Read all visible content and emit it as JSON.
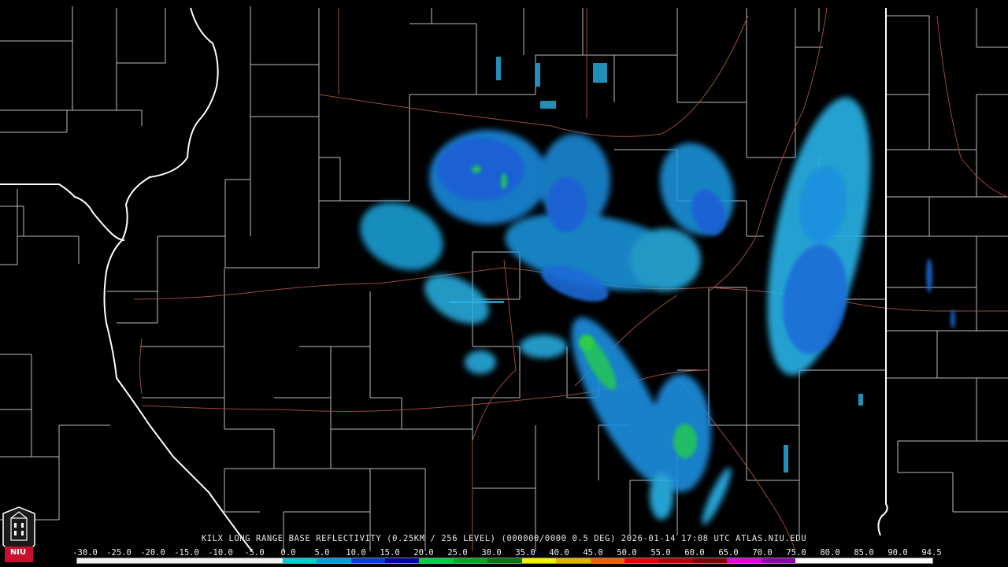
{
  "product": {
    "caption": "KILX LONG RANGE BASE REFLECTIVITY (0.25KM / 256 LEVEL) (000000/0000 0.5 DEG) 2026-01-14 17:08 UTC  ATLAS.NIU.EDU",
    "station": "KILX",
    "date": "2026-01-14",
    "time_utc": "17:08"
  },
  "logo": {
    "text": "NIU",
    "color": "#c8102e"
  },
  "scale": {
    "labels": [
      "-30.0",
      "-25.0",
      "-20.0",
      "-15.0",
      "-10.0",
      "-5.0",
      "0.0",
      "5.0",
      "10.0",
      "15.0",
      "20.0",
      "25.0",
      "30.0",
      "35.0",
      "40.0",
      "45.0",
      "50.0",
      "55.0",
      "60.0",
      "65.0",
      "70.0",
      "75.0",
      "80.0",
      "85.0",
      "90.0",
      "94.5"
    ],
    "colors": [
      "#f2f2f2",
      "#f2f2f2",
      "#f2f2f2",
      "#f2f2f2",
      "#f2f2f2",
      "#f2f2f2",
      "#00ccd8",
      "#0098e8",
      "#0040d0",
      "#0000a0",
      "#00d040",
      "#00a820",
      "#007810",
      "#f0f000",
      "#e0b000",
      "#f06000",
      "#e00000",
      "#b00000",
      "#800000",
      "#e000e0",
      "#9000b0",
      "#ffffff",
      "#ffffff",
      "#ffffff",
      "#ffffff"
    ]
  },
  "map": {
    "state_border_color": "#ffffff",
    "county_border_color": "#c8c8c8",
    "highway_color": "#9a4a3a"
  }
}
